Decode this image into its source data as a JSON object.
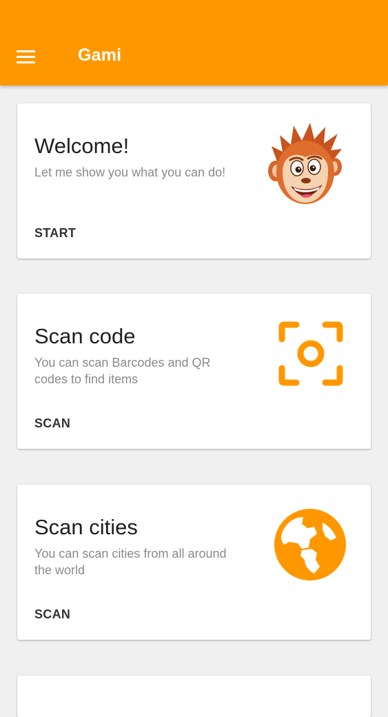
{
  "app": {
    "title": "Gami",
    "accent": "#ff9800"
  },
  "toolbar": {
    "menu_icon": "hamburger-menu-icon"
  },
  "cards": [
    {
      "title": "Welcome!",
      "description": "Let me show you what you can do!",
      "action": "START",
      "icon": "monkey-mascot-icon"
    },
    {
      "title": "Scan code",
      "description": "You can scan Barcodes and QR codes to find items",
      "action": "SCAN",
      "icon": "scan-frame-icon"
    },
    {
      "title": "Scan cities",
      "description": "You can scan cities from all around the world",
      "action": "SCAN",
      "icon": "globe-icon"
    }
  ]
}
